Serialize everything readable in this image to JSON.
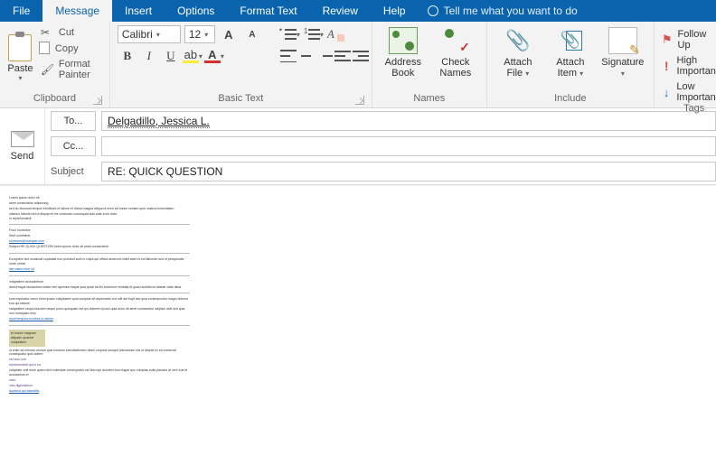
{
  "tabs": {
    "file": "File",
    "message": "Message",
    "insert": "Insert",
    "options": "Options",
    "format_text": "Format Text",
    "review": "Review",
    "help": "Help",
    "tell_me": "Tell me what you want to do"
  },
  "ribbon": {
    "clipboard": {
      "label": "Clipboard",
      "paste": "Paste",
      "cut": "Cut",
      "copy": "Copy",
      "format_painter": "Format Painter"
    },
    "basic_text": {
      "label": "Basic Text",
      "font_name": "Calibri",
      "font_size": "12"
    },
    "names": {
      "label": "Names",
      "address_book": "Address Book",
      "check_names": "Check Names"
    },
    "include": {
      "label": "Include",
      "attach_file": "Attach File",
      "attach_item": "Attach Item",
      "signature": "Signature"
    },
    "tags": {
      "label": "Tags",
      "follow_up": "Follow Up",
      "high": "High Importance",
      "low": "Low Importance"
    }
  },
  "header": {
    "send": "Send",
    "to_btn": "To...",
    "cc_btn": "Cc...",
    "subject_label": "Subject",
    "to_value": "Delgadillo, Jessica L.",
    "cc_value": "",
    "subject_value": "RE: QUICK QUESTION"
  }
}
